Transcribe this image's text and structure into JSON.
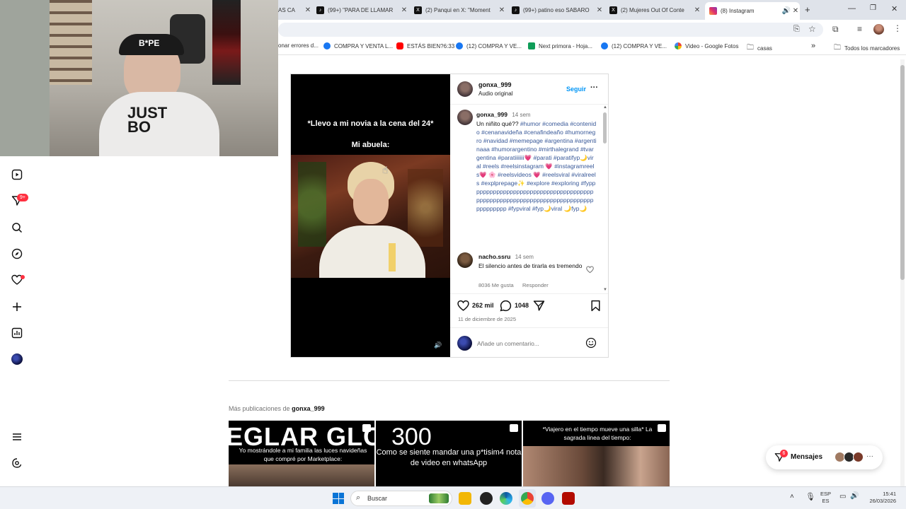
{
  "browser": {
    "tabs": [
      {
        "title": "AS CA",
        "active": false
      },
      {
        "title": "(99+) \"PARA DE LLAMAR",
        "active": false
      },
      {
        "title": "(2) Panqui en X: \"Moment",
        "active": false
      },
      {
        "title": "(99+) patino eso SABARO",
        "active": false
      },
      {
        "title": "(2) Mujeres Out Of Conte",
        "active": false
      },
      {
        "title": "(8) Instagram",
        "active": true
      }
    ],
    "new_tab": "+",
    "bookmarks": [
      {
        "label": "onar errores d...",
        "icon": "bookmark-icon"
      },
      {
        "label": "COMPRA Y VENTA L...",
        "icon": "facebook-icon"
      },
      {
        "label": "ESTÁS BIEN?6:33",
        "icon": "youtube-icon"
      },
      {
        "label": "(12) COMPRA Y VE...",
        "icon": "facebook-icon"
      },
      {
        "label": "Next primora - Hoja...",
        "icon": "sheets-icon"
      },
      {
        "label": "(12) COMPRA Y VE...",
        "icon": "facebook-icon"
      },
      {
        "label": "Video - Google Fotos",
        "icon": "photos-icon"
      },
      {
        "label": "casas",
        "icon": "folder-icon"
      }
    ],
    "all_bookmarks": "Todos los marcadores",
    "more": "»"
  },
  "sidebar": {
    "notification_badge": "9+",
    "icons": [
      "reels-icon",
      "direct-icon",
      "search-icon",
      "explore-icon",
      "heart-icon",
      "create-icon",
      "dashboard-icon",
      "profile-avatar",
      "menu-icon",
      "threads-icon"
    ]
  },
  "post": {
    "video_text_top": "*Llevo a mi novia a la cena del 24*",
    "video_text_mid": "Mi abuela:",
    "header": {
      "username": "gonxa_999",
      "audio": "Audio original",
      "follow": "Seguir",
      "more": "···"
    },
    "caption": {
      "username": "gonxa_999",
      "time": "14 sem",
      "text": "Un niñito qué??",
      "hashtags": "#humor #comedia #contenido #cenanavideña #cenafindeaño #humornegro #navidad #memepage #argentina #argentinaаа #humorargentino #mirthalegrand #tvargentina #paratiiiiiii💗 #parati #paratifyp🌙viral #reels #reelsinstagram 💗 #instagramreels💗 🌸 #reelsvideos 💗 #reelsviral #viralreels #explprepage✨ #explore #exploring #fyppppppppppppppppppppppppppppppppppppppppppppppppppppppppppppppppppppppppppppppppp #fypviral #fyp🌙viral 🌙fyp🌙"
    },
    "comment": {
      "username": "nacho.ssru",
      "time": "14 sem",
      "text": "El silencio antes de tirarla es tremendo",
      "likes": "8036 Me gusta",
      "reply": "Responder"
    },
    "likes_count": "262 mil",
    "comments_count": "1048",
    "date": "11 de diciembre de 2025",
    "comment_placeholder": "Añade un comentario..."
  },
  "more_posts": {
    "label_prefix": "Más publicaciones de",
    "username": "gonxa_999",
    "thumbs": [
      {
        "big": "EGLAR GLC",
        "small": "Yo mostrándole a mi familia las luces navideñas que compré por Marketplace:"
      },
      {
        "big": "300",
        "small": "Como se siente mandar una p*tisim4 nota de video en whatsApp"
      },
      {
        "big": "",
        "small": "*Viajero en el tiempo mueve una silla* La sagrada linea del tiempo:"
      }
    ]
  },
  "messages": {
    "label": "Mensajes",
    "badge": "6"
  },
  "taskbar": {
    "search_placeholder": "Buscar",
    "lang_top": "ESP",
    "lang_bottom": "ES",
    "time": "15:41",
    "date": "26/03/2026"
  },
  "colors": {
    "ig_blue": "#0095f6",
    "link_blue": "#385898",
    "notification_red": "#ff3040"
  }
}
